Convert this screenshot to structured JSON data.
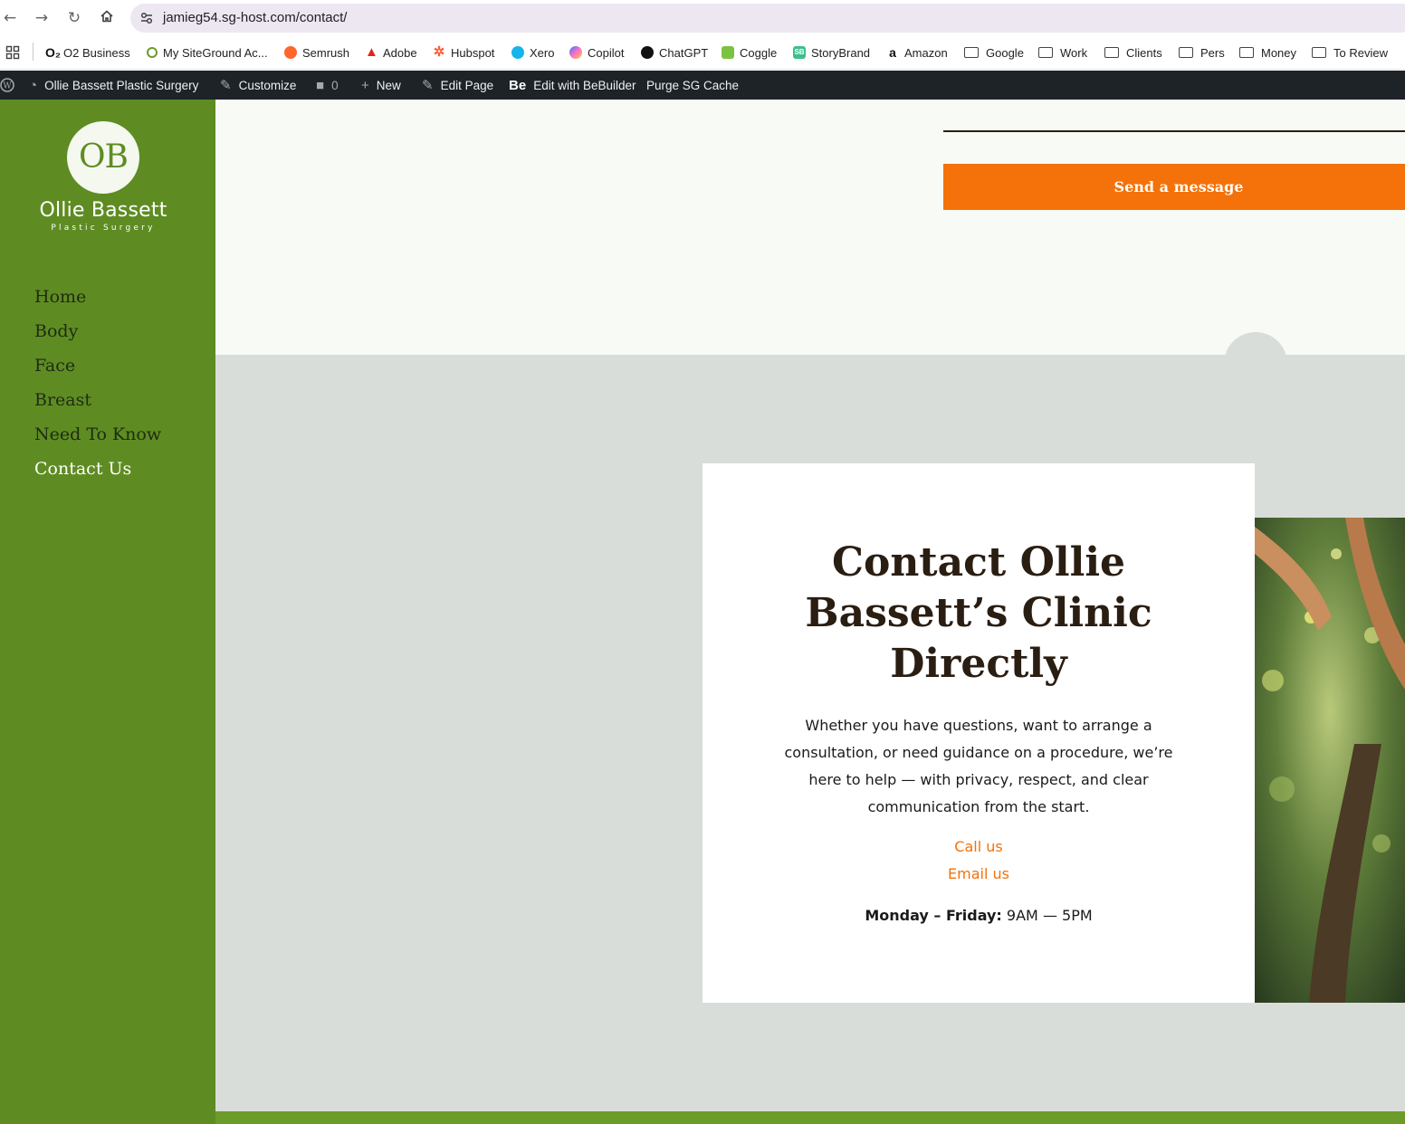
{
  "browser": {
    "url": "jamieg54.sg-host.com/contact/",
    "bookmarks": [
      "O2 Business",
      "My SiteGround Ac...",
      "Semrush",
      "Adobe",
      "Hubspot",
      "Xero",
      "Copilot",
      "ChatGPT",
      "Coggle",
      "StoryBrand",
      "Amazon",
      "Google",
      "Work",
      "Clients",
      "Pers",
      "Money",
      "To Review"
    ]
  },
  "adminbar": {
    "site_name": "Ollie Bassett Plastic Surgery",
    "customize": "Customize",
    "comments_count": "0",
    "new": "New",
    "edit_page": "Edit Page",
    "bebuilder": "Edit with BeBuilder",
    "purge": "Purge SG Cache"
  },
  "sidebar": {
    "logo_initials": "OB",
    "logo_name": "Ollie Bassett",
    "logo_sub": "Plastic Surgery",
    "menu": [
      "Home",
      "Body",
      "Face",
      "Breast",
      "Need To Know",
      "Contact Us"
    ]
  },
  "form": {
    "send_label": "Send a message"
  },
  "card": {
    "title": "Contact Ollie Bassett’s Clinic Directly",
    "body": "Whether you have questions, want to arrange a consultation, or need guidance on a procedure, we’re here to help — with privacy, respect, and clear communication from the start.",
    "call": "Call us",
    "email": "Email us",
    "hours_label": "Monday – Friday:",
    "hours_value": "9AM — 5PM"
  },
  "colors": {
    "sidebar_green": "#5e8c22",
    "accent_orange": "#f47209",
    "dark_text": "#2a1d12"
  }
}
